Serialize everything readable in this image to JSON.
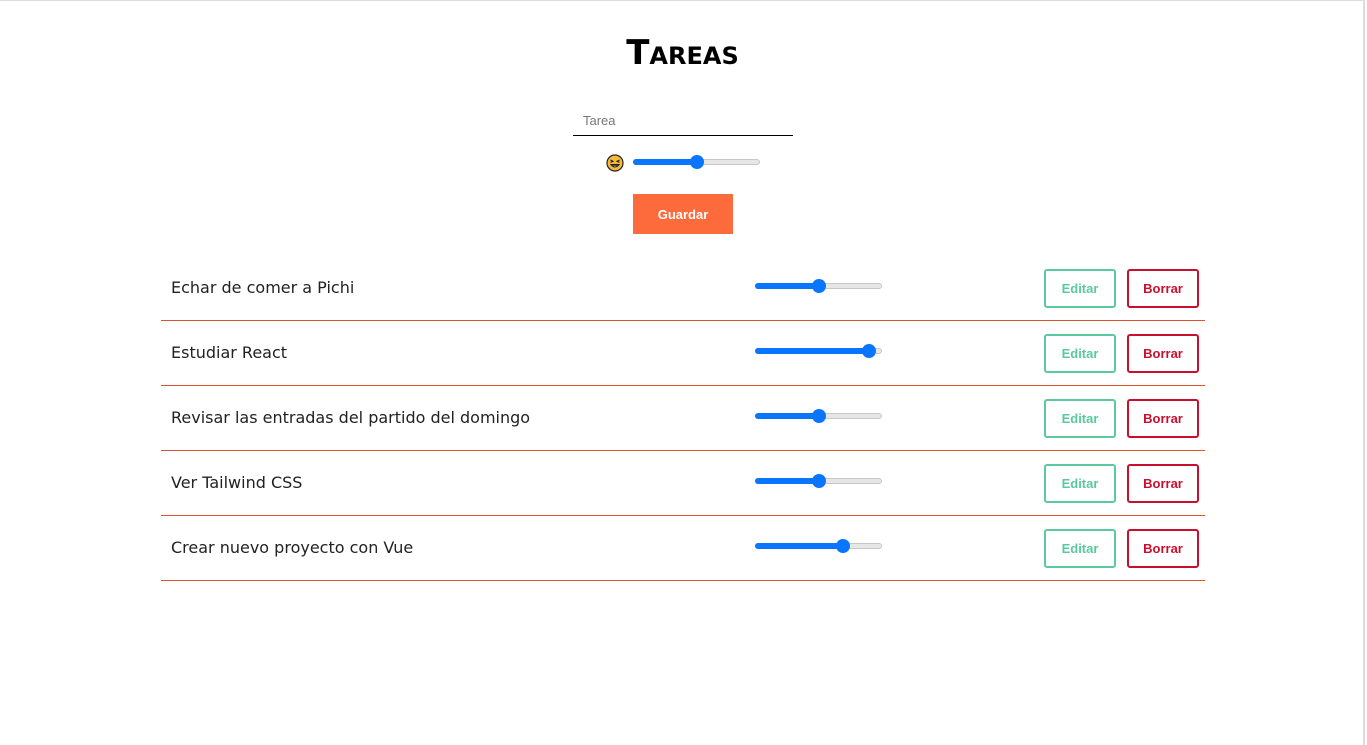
{
  "header": {
    "title": "Tareas"
  },
  "form": {
    "input_placeholder": "Tarea",
    "input_value": "",
    "emoji_icon": "grinning-squinting-face-icon",
    "range_value": 50,
    "save_label": "Guardar"
  },
  "tasks": [
    {
      "label": "Echar de comer a Pichi",
      "value": 50,
      "edit_label": "Editar",
      "delete_label": "Borrar"
    },
    {
      "label": "Estudiar React",
      "value": 95,
      "edit_label": "Editar",
      "delete_label": "Borrar"
    },
    {
      "label": "Revisar las entradas del partido del domingo",
      "value": 50,
      "edit_label": "Editar",
      "delete_label": "Borrar"
    },
    {
      "label": "Ver Tailwind CSS",
      "value": 50,
      "edit_label": "Editar",
      "delete_label": "Borrar"
    },
    {
      "label": "Crear nuevo proyecto con Vue",
      "value": 72,
      "edit_label": "Editar",
      "delete_label": "Borrar"
    }
  ],
  "colors": {
    "accent": "#0a75ff",
    "save": "#fd6a3c",
    "edit": "#5bc9a0",
    "delete": "#c8102e",
    "divider": "#e0522b"
  }
}
